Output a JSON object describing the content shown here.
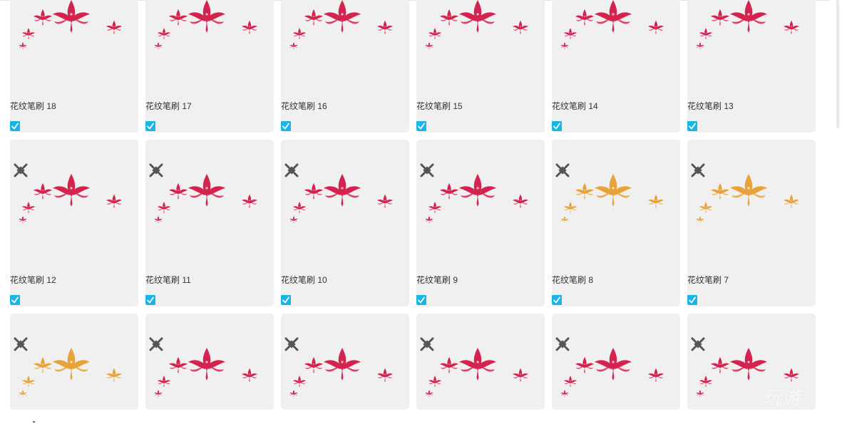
{
  "brushes": [
    {
      "name": "花纹笔刷 18",
      "checked": true,
      "palette": "red"
    },
    {
      "name": "花纹笔刷 17",
      "checked": true,
      "palette": "red"
    },
    {
      "name": "花纹笔刷 16",
      "checked": true,
      "palette": "red"
    },
    {
      "name": "花纹笔刷 15",
      "checked": true,
      "palette": "red"
    },
    {
      "name": "花纹笔刷 14",
      "checked": true,
      "palette": "red"
    },
    {
      "name": "花纹笔刷 13",
      "checked": true,
      "palette": "red"
    },
    {
      "name": "花纹笔刷 12",
      "checked": true,
      "palette": "red"
    },
    {
      "name": "花纹笔刷 11",
      "checked": true,
      "palette": "red"
    },
    {
      "name": "花纹笔刷 10",
      "checked": true,
      "palette": "red"
    },
    {
      "name": "花纹笔刷 9",
      "checked": true,
      "palette": "red"
    },
    {
      "name": "花纹笔刷 8",
      "checked": true,
      "palette": "gold"
    },
    {
      "name": "花纹笔刷 7",
      "checked": true,
      "palette": "gold"
    },
    {
      "name": "",
      "checked": false,
      "palette": "gold"
    },
    {
      "name": "",
      "checked": false,
      "palette": "red"
    },
    {
      "name": "",
      "checked": false,
      "palette": "red"
    },
    {
      "name": "",
      "checked": false,
      "palette": "red"
    },
    {
      "name": "",
      "checked": false,
      "palette": "red"
    },
    {
      "name": "",
      "checked": false,
      "palette": "red"
    }
  ],
  "colors": {
    "card_bg": "#f0f0f0",
    "check_bg": "#17b5e8",
    "brush_red": "#d3244f",
    "brush_gold": "#e8a23a",
    "status_icon": "#555555"
  },
  "icons": {
    "status": "brush-status-icon",
    "check": "checkmark-icon"
  },
  "watermark": "玩游"
}
